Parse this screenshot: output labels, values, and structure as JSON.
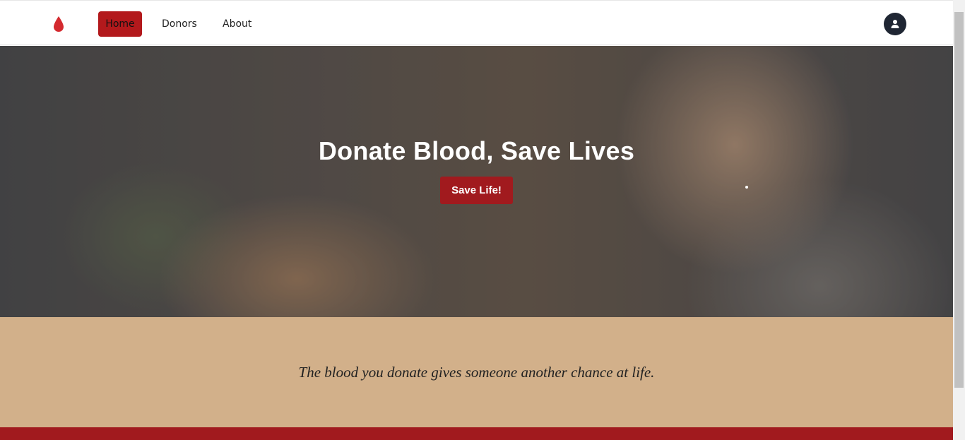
{
  "navbar": {
    "logo_icon": "blood-drop-icon",
    "items": [
      {
        "label": "Home",
        "active": true
      },
      {
        "label": "Donors",
        "active": false
      },
      {
        "label": "About",
        "active": false
      }
    ],
    "profile_icon": "user-icon"
  },
  "hero": {
    "title": "Donate Blood, Save Lives",
    "button_label": "Save Life!"
  },
  "quote": {
    "text": "The blood you donate gives someone another chance at life."
  },
  "colors": {
    "accent": "#a11a1e",
    "active_nav": "#b3191c",
    "quote_bg": "#d2b08a",
    "avatar_bg": "#1f2633"
  }
}
